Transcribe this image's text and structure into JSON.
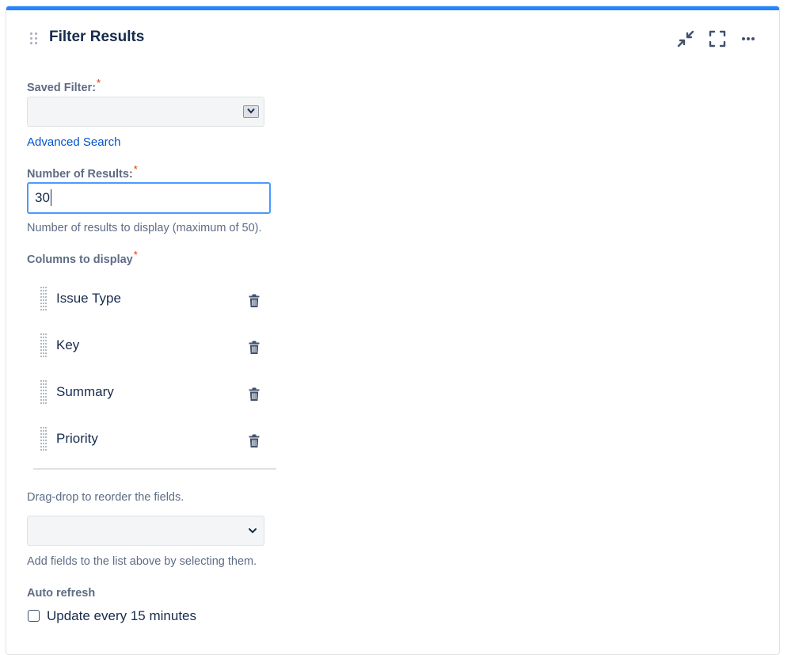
{
  "gadget": {
    "title": "Filter Results",
    "accent_color": "#2684ff",
    "header_icons": [
      "minimize-icon",
      "fullscreen-icon",
      "more-icon"
    ]
  },
  "form": {
    "saved_filter": {
      "label": "Saved Filter:",
      "required_mark": "*",
      "value": ""
    },
    "advanced_search_link": "Advanced Search",
    "number_of_results": {
      "label": "Number of Results:",
      "required_mark": "*",
      "value": "30",
      "help": "Number of results to display (maximum of 50)."
    },
    "columns": {
      "label": "Columns to display",
      "required_mark": "*",
      "items": [
        {
          "label": "Issue Type"
        },
        {
          "label": "Key"
        },
        {
          "label": "Summary"
        },
        {
          "label": "Priority"
        }
      ],
      "reorder_help": "Drag-drop to reorder the fields.",
      "add_field_value": "",
      "add_help": "Add fields to the list above by selecting them."
    },
    "auto_refresh": {
      "label": "Auto refresh",
      "checkbox_label": "Update every 15 minutes",
      "checked": false
    }
  }
}
